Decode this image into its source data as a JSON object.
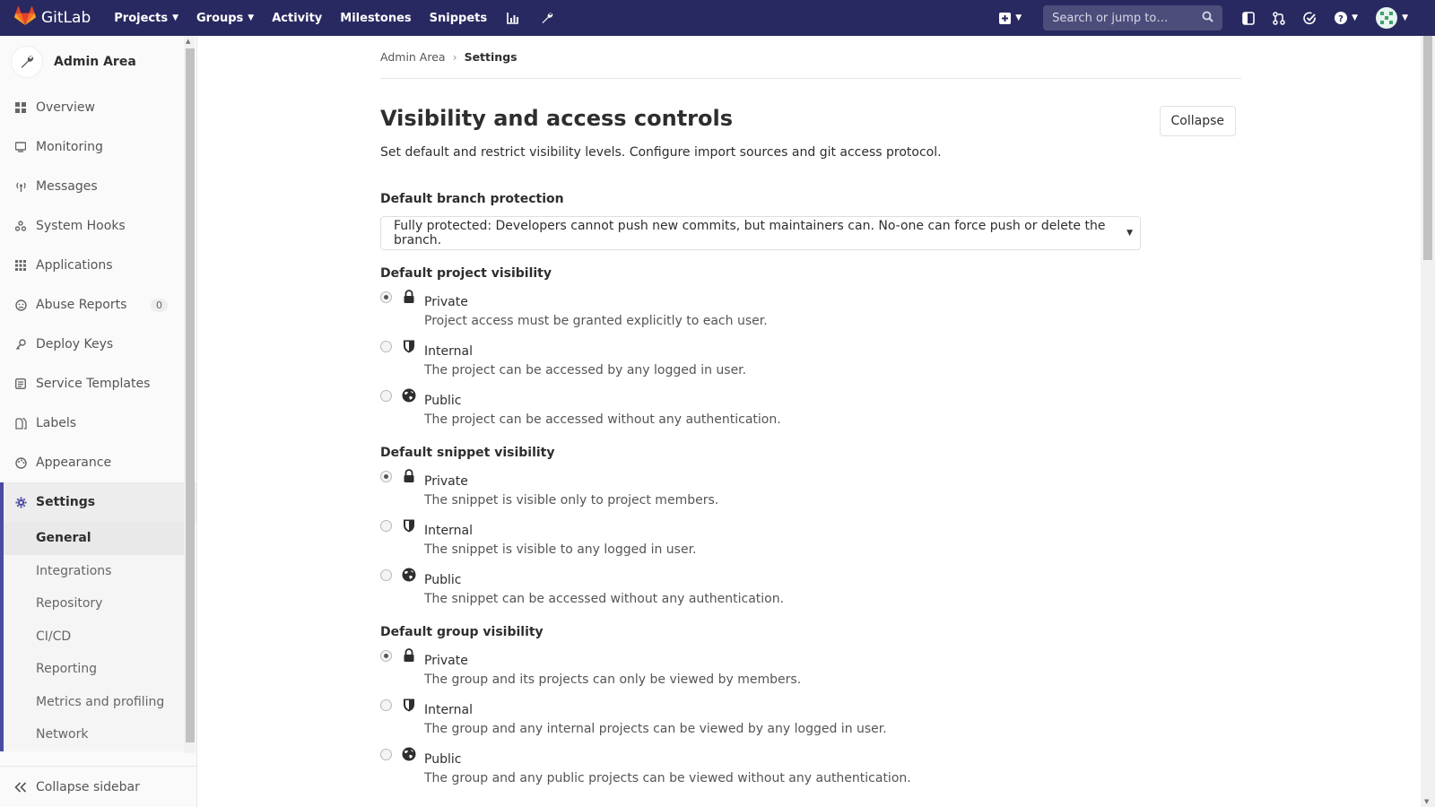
{
  "navbar": {
    "brand": "GitLab",
    "links": [
      {
        "label": "Projects",
        "has_caret": true
      },
      {
        "label": "Groups",
        "has_caret": true
      },
      {
        "label": "Activity",
        "has_caret": false
      },
      {
        "label": "Milestones",
        "has_caret": false
      },
      {
        "label": "Snippets",
        "has_caret": false
      }
    ],
    "search_placeholder": "Search or jump to…",
    "caret": "⌄",
    "bg_color": "#292961"
  },
  "sidebar": {
    "context_title": "Admin Area",
    "items": [
      {
        "label": "Overview",
        "icon": "overview-icon"
      },
      {
        "label": "Monitoring",
        "icon": "monitoring-icon"
      },
      {
        "label": "Messages",
        "icon": "messages-icon"
      },
      {
        "label": "System Hooks",
        "icon": "hook-icon"
      },
      {
        "label": "Applications",
        "icon": "applications-icon"
      },
      {
        "label": "Abuse Reports",
        "icon": "abuse-icon",
        "badge": "0"
      },
      {
        "label": "Deploy Keys",
        "icon": "key-icon"
      },
      {
        "label": "Service Templates",
        "icon": "template-icon"
      },
      {
        "label": "Labels",
        "icon": "label-icon"
      },
      {
        "label": "Appearance",
        "icon": "appearance-icon"
      }
    ],
    "settings_label": "Settings",
    "settings_sub": [
      "General",
      "Integrations",
      "Repository",
      "CI/CD",
      "Reporting",
      "Metrics and profiling",
      "Network"
    ],
    "collapse_label": "Collapse sidebar"
  },
  "breadcrumb": {
    "parent": "Admin Area",
    "current": "Settings",
    "sep": "›"
  },
  "section": {
    "title": "Visibility and access controls",
    "description": "Set default and restrict visibility levels. Configure import sources and git access protocol.",
    "collapse_label": "Collapse"
  },
  "branch_protection": {
    "label": "Default branch protection",
    "value": "Fully protected: Developers cannot push new commits, but maintainers can. No-one can force push or delete the branch."
  },
  "project_visibility": {
    "label": "Default project visibility",
    "selected": "Private",
    "options": [
      {
        "label": "Private",
        "help": "Project access must be granted explicitly to each user."
      },
      {
        "label": "Internal",
        "help": "The project can be accessed by any logged in user."
      },
      {
        "label": "Public",
        "help": "The project can be accessed without any authentication."
      }
    ]
  },
  "snippet_visibility": {
    "label": "Default snippet visibility",
    "selected": "Private",
    "options": [
      {
        "label": "Private",
        "help": "The snippet is visible only to project members."
      },
      {
        "label": "Internal",
        "help": "The snippet is visible to any logged in user."
      },
      {
        "label": "Public",
        "help": "The snippet can be accessed without any authentication."
      }
    ]
  },
  "group_visibility": {
    "label": "Default group visibility",
    "selected": "Private",
    "options": [
      {
        "label": "Private",
        "help": "The group and its projects can only be viewed by members."
      },
      {
        "label": "Internal",
        "help": "The group and any internal projects can be viewed by any logged in user."
      },
      {
        "label": "Public",
        "help": "The group and any public projects can be viewed without any authentication."
      }
    ]
  }
}
